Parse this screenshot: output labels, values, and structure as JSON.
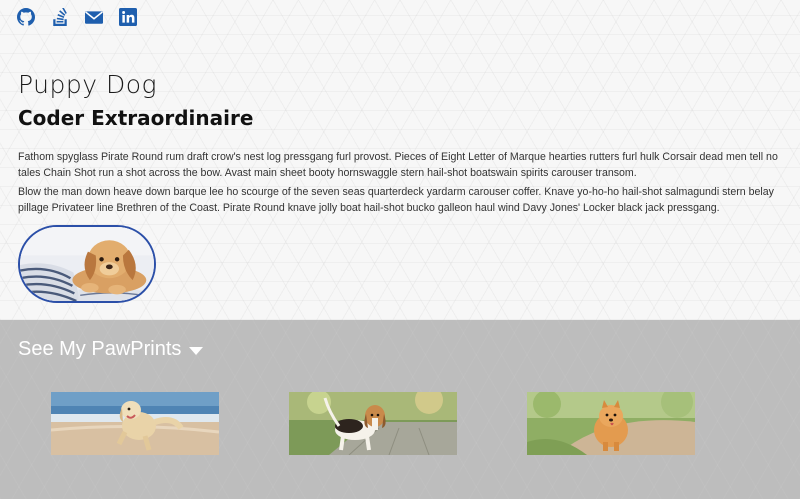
{
  "social": {
    "links": [
      {
        "icon": "github-icon",
        "color": "#1f5fae"
      },
      {
        "icon": "stack-overflow-icon",
        "color": "#1f5fae"
      },
      {
        "icon": "envelope-icon",
        "color": "#1f5fae"
      },
      {
        "icon": "linkedin-icon",
        "color": "#1f5fae"
      }
    ]
  },
  "intro": {
    "name": "Puppy Dog",
    "title": "Coder Extraordinaire",
    "paragraphs": [
      "Fathom spyglass Pirate Round rum draft crow's nest log pressgang furl provost. Pieces of Eight Letter of Marque hearties rutters furl hulk Corsair dead men tell no tales Chain Shot run a shot across the bow. Avast main sheet booty hornswaggle stern hail-shot boatswain spirits carouser transom.",
      "Blow the man down heave down barque lee ho scourge of the seven seas quarterdeck yardarm carouser coffer. Knave yo-ho-ho hail-shot salmagundi stern belay pillage Privateer line Brethren of the Coast. Pirate Round knave jolly boat hail-shot bucko galleon haul wind Davy Jones' Locker black jack pressgang."
    ]
  },
  "portfolio": {
    "toggle_label": "See My PawPrints",
    "cards": [
      {
        "subject": "golden retriever running on beach"
      },
      {
        "subject": "beagle on brick path"
      },
      {
        "subject": "pomeranian on dirt path"
      }
    ]
  },
  "colors": {
    "accent": "#1f5fae",
    "portrait_border": "#2b4fa8",
    "bottom_background": "#bdbdbd"
  }
}
